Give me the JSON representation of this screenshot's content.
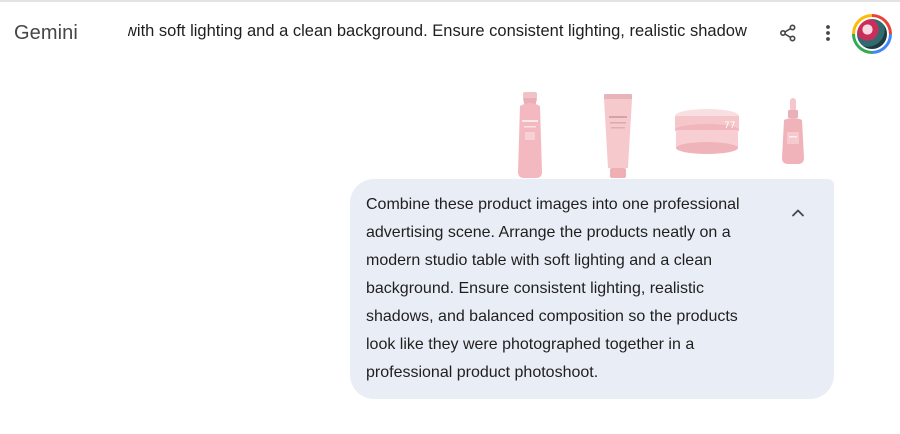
{
  "app": {
    "brand": "Gemini"
  },
  "header": {
    "title": "with soft lighting and a clean background. Ensure consistent lighting, realistic shadow",
    "share_icon": "share-icon",
    "more_icon": "more-vert-icon"
  },
  "attachments": [
    {
      "name": "pink-toner-bottle"
    },
    {
      "name": "pink-cleanser-tube"
    },
    {
      "name": "pink-cream-jar"
    },
    {
      "name": "pink-serum-dropper"
    }
  ],
  "prompt": {
    "text": "Combine these product images into one professional advertising scene. Arrange the products neatly on a modern studio table with soft lighting and a clean background. Ensure consistent lighting, realistic shadows, and balanced composition so the products look like they were photographed together in a professional product photoshoot.",
    "collapse_icon": "chevron-up-icon"
  },
  "colors": {
    "bubble_bg": "#e9eef6",
    "product_pink": "#f3b8bf"
  }
}
